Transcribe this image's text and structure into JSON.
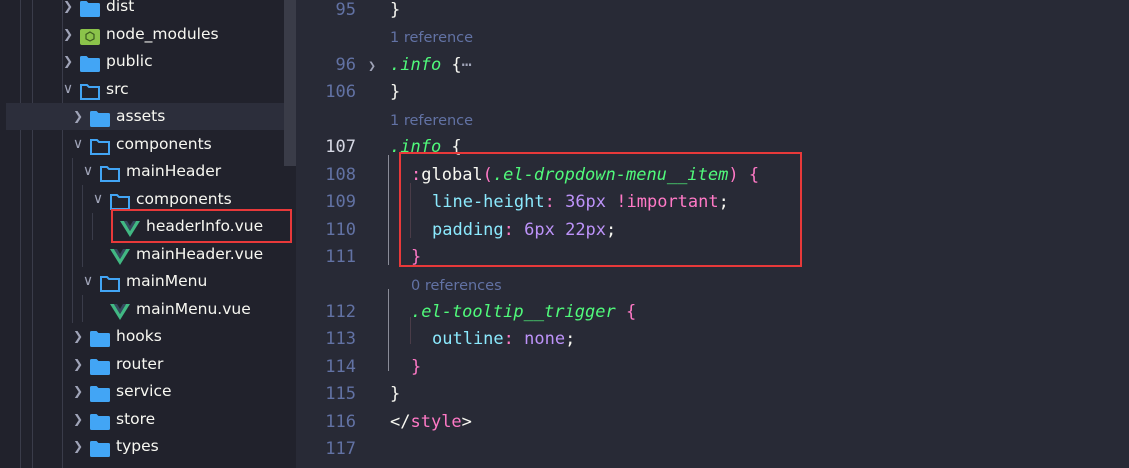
{
  "explorer": {
    "items": [
      {
        "label": "dist",
        "depth": 0,
        "kind": "folder",
        "open": false
      },
      {
        "label": "node_modules",
        "depth": 0,
        "kind": "node",
        "open": false
      },
      {
        "label": "public",
        "depth": 0,
        "kind": "folder",
        "open": false
      },
      {
        "label": "src",
        "depth": 0,
        "kind": "folder",
        "open": true
      },
      {
        "label": "assets",
        "depth": 1,
        "kind": "folder",
        "open": false,
        "hover": true
      },
      {
        "label": "components",
        "depth": 1,
        "kind": "folder",
        "open": true
      },
      {
        "label": "mainHeader",
        "depth": 2,
        "kind": "folder",
        "open": true
      },
      {
        "label": "components",
        "depth": 3,
        "kind": "folder",
        "open": true
      },
      {
        "label": "headerInfo.vue",
        "depth": 4,
        "kind": "vue",
        "highlight": true
      },
      {
        "label": "mainHeader.vue",
        "depth": 3,
        "kind": "vue"
      },
      {
        "label": "mainMenu",
        "depth": 2,
        "kind": "folder",
        "open": true
      },
      {
        "label": "mainMenu.vue",
        "depth": 3,
        "kind": "vue"
      },
      {
        "label": "hooks",
        "depth": 1,
        "kind": "folder",
        "open": false
      },
      {
        "label": "router",
        "depth": 1,
        "kind": "folder",
        "open": false
      },
      {
        "label": "service",
        "depth": 1,
        "kind": "folder",
        "open": false
      },
      {
        "label": "store",
        "depth": 1,
        "kind": "folder",
        "open": false
      },
      {
        "label": "types",
        "depth": 1,
        "kind": "folder",
        "open": false
      }
    ]
  },
  "colors": {
    "folder": "#42a5f5",
    "vue": "#41b883",
    "node": "#8bc34a",
    "highlight": "#e8393a"
  },
  "editor": {
    "lines": [
      {
        "num": "95",
        "tokens": [
          [
            "}",
            "#f8f8f2",
            ""
          ]
        ],
        "indent": 0
      },
      {
        "lens": "1 reference"
      },
      {
        "num": "96",
        "fold": true,
        "tokens": [
          [
            ".info",
            "#50fa7b",
            "i"
          ],
          [
            " {",
            "#f8f8f2",
            ""
          ],
          [
            "⋯",
            "#a0a4b8",
            ""
          ]
        ],
        "indent": 0
      },
      {
        "num": "106",
        "tokens": [
          [
            "}",
            "#f8f8f2",
            ""
          ]
        ],
        "indent": 0
      },
      {
        "lens": "1 reference"
      },
      {
        "num": "107",
        "current": true,
        "tokens": [
          [
            ".info",
            "#50fa7b",
            "i"
          ],
          [
            " {",
            "#f8f8f2",
            ""
          ]
        ],
        "indent": 0
      },
      {
        "num": "108",
        "tokens": [
          [
            ":",
            "#ff79c6",
            ""
          ],
          [
            "global",
            "#f8f8f2",
            ""
          ],
          [
            "(",
            "#ff79c6",
            ""
          ],
          [
            ".el-dropdown-menu__item",
            "#50fa7b",
            "i"
          ],
          [
            ")",
            "#ff79c6",
            ""
          ],
          [
            " {",
            "#ff79c6",
            ""
          ]
        ],
        "indent": 1
      },
      {
        "num": "109",
        "tokens": [
          [
            "line-height",
            "#8be9fd",
            ""
          ],
          [
            ": ",
            "#ff79c6",
            ""
          ],
          [
            "36px",
            "#bd93f9",
            ""
          ],
          [
            " !important",
            "#ff79c6",
            ""
          ],
          [
            ";",
            "#f8f8f2",
            ""
          ]
        ],
        "indent": 2
      },
      {
        "num": "110",
        "tokens": [
          [
            "padding",
            "#8be9fd",
            ""
          ],
          [
            ": ",
            "#ff79c6",
            ""
          ],
          [
            "6px 22px",
            "#bd93f9",
            ""
          ],
          [
            ";",
            "#f8f8f2",
            ""
          ]
        ],
        "indent": 2
      },
      {
        "num": "111",
        "tokens": [
          [
            "}",
            "#ff79c6",
            ""
          ]
        ],
        "indent": 1
      },
      {
        "lens": "0 references",
        "indent": 1
      },
      {
        "num": "112",
        "tokens": [
          [
            ".el-tooltip__trigger",
            "#50fa7b",
            "i"
          ],
          [
            " {",
            "#ff79c6",
            ""
          ]
        ],
        "indent": 1
      },
      {
        "num": "113",
        "tokens": [
          [
            "outline",
            "#8be9fd",
            ""
          ],
          [
            ": ",
            "#ff79c6",
            ""
          ],
          [
            "none",
            "#bd93f9",
            ""
          ],
          [
            ";",
            "#f8f8f2",
            ""
          ]
        ],
        "indent": 2
      },
      {
        "num": "114",
        "tokens": [
          [
            "}",
            "#ff79c6",
            ""
          ]
        ],
        "indent": 1
      },
      {
        "num": "115",
        "tokens": [
          [
            "}",
            "#f8f8f2",
            ""
          ]
        ],
        "indent": 0
      },
      {
        "num": "116",
        "tokens": [
          [
            "</",
            "#f8f8f2",
            ""
          ],
          [
            "style",
            "#ff79c6",
            ""
          ],
          [
            ">",
            "#f8f8f2",
            ""
          ]
        ],
        "indent": 0
      },
      {
        "num": "117",
        "tokens": [],
        "indent": 0
      }
    ]
  }
}
